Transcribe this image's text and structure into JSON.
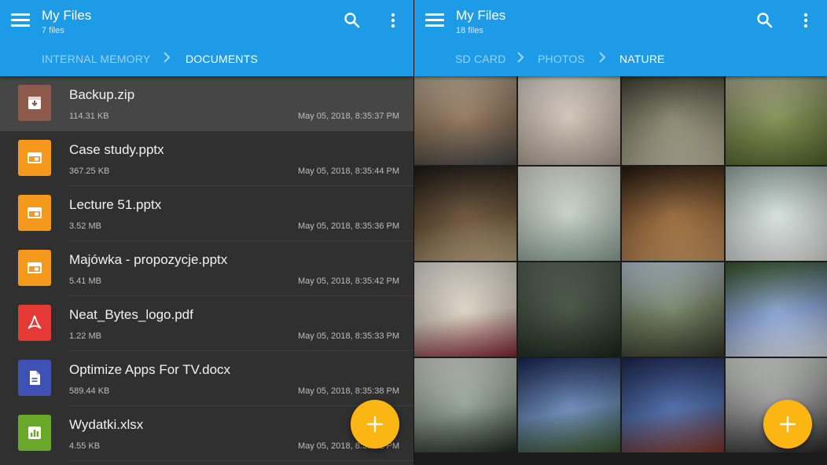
{
  "left_pane": {
    "title": "My Files",
    "subtitle": "7 files",
    "breadcrumb": [
      "INTERNAL MEMORY",
      "DOCUMENTS"
    ],
    "files": [
      {
        "name": "Backup.zip",
        "size": "114.31 KB",
        "date": "May 05, 2018, 8:35:37 PM",
        "icon": "archive-icon",
        "color": "#8d5a4c"
      },
      {
        "name": "Case study.pptx",
        "size": "367.25 KB",
        "date": "May 05, 2018, 8:35:44 PM",
        "icon": "presentation-icon",
        "color": "#f5991d"
      },
      {
        "name": "Lecture 51.pptx",
        "size": "3.52 MB",
        "date": "May 05, 2018, 8:35:36 PM",
        "icon": "presentation-icon",
        "color": "#f5991d"
      },
      {
        "name": "Majówka - propozycje.pptx",
        "size": "5.41 MB",
        "date": "May 05, 2018, 8:35:42 PM",
        "icon": "presentation-icon",
        "color": "#f5991d"
      },
      {
        "name": "Neat_Bytes_logo.pdf",
        "size": "1.22 MB",
        "date": "May 05, 2018, 8:35:33 PM",
        "icon": "pdf-icon",
        "color": "#e53935"
      },
      {
        "name": "Optimize Apps For TV.docx",
        "size": "589.44 KB",
        "date": "May 05, 2018, 8:35:38 PM",
        "icon": "document-icon",
        "color": "#3f51b5"
      },
      {
        "name": "Wydatki.xlsx",
        "size": "4.55 KB",
        "date": "May 05, 2018, 8:35:52 PM",
        "icon": "spreadsheet-icon",
        "color": "#6aa82a"
      }
    ]
  },
  "right_pane": {
    "title": "My Files",
    "subtitle": "18 files",
    "breadcrumb": [
      "SD CARD",
      "PHOTOS",
      "NATURE"
    ],
    "photos": [
      {
        "name": "bicycle-brick-wall",
        "colors": [
          "#c8b7a0",
          "#8a6f55",
          "#4a4a4a"
        ]
      },
      {
        "name": "hazy-clouds",
        "colors": [
          "#e8e0d8",
          "#cdbfb2",
          "#bcae9f"
        ]
      },
      {
        "name": "railway-track",
        "colors": [
          "#3a3a2e",
          "#8c8a70",
          "#cfcab0"
        ]
      },
      {
        "name": "soccer-ball-grass",
        "colors": [
          "#b8b89c",
          "#7d8a4c",
          "#556b2f"
        ]
      },
      {
        "name": "attic-chair",
        "colors": [
          "#1e1a16",
          "#6b5236",
          "#c9b48a"
        ]
      },
      {
        "name": "beach-rocks",
        "colors": [
          "#e9ece2",
          "#c0cdc2",
          "#9bb2a8"
        ]
      },
      {
        "name": "sunset-plant",
        "colors": [
          "#2a1a10",
          "#9a6a3a",
          "#d8a066"
        ]
      },
      {
        "name": "snowy-trees",
        "colors": [
          "#a7b8b2",
          "#d6e2de",
          "#f2f4f2"
        ]
      },
      {
        "name": "beach-chairs",
        "colors": [
          "#f3efe6",
          "#d8cfbe",
          "#8a2a3a"
        ]
      },
      {
        "name": "foggy-field",
        "colors": [
          "#5c6a5a",
          "#3c4a3a",
          "#1e2a1e"
        ]
      },
      {
        "name": "cows-pasture",
        "colors": [
          "#c7d6e4",
          "#6b7a5c",
          "#3a3a2a"
        ]
      },
      {
        "name": "sky-reflection-leaves",
        "colors": [
          "#3c5a2a",
          "#8aa4d8",
          "#f0f4fa"
        ]
      },
      {
        "name": "cloudy-mountains",
        "colors": [
          "#dfe4dc",
          "#8a9a8a",
          "#1e2a22"
        ]
      },
      {
        "name": "mountain-valley",
        "colors": [
          "#1a2a5a",
          "#6a8ab8",
          "#3c5a2a"
        ]
      },
      {
        "name": "red-house-lake",
        "colors": [
          "#1e2a5a",
          "#4a6aa8",
          "#8a3a2a"
        ]
      },
      {
        "name": "city-railway",
        "colors": [
          "#e8ece8",
          "#8a8a8a",
          "#2a2a2a"
        ]
      }
    ]
  },
  "theme": {
    "appbar": "#1e9be6",
    "fab": "#fbb614"
  }
}
